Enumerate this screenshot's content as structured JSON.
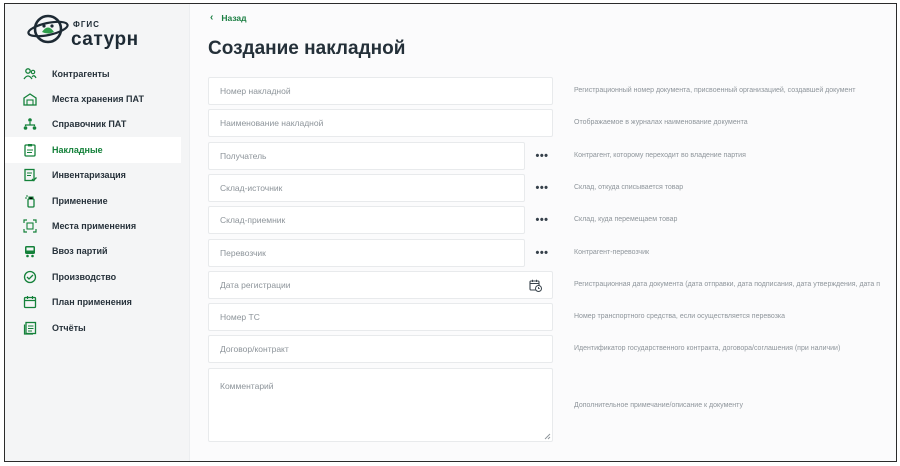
{
  "app": {
    "brand_top": "ФГИС",
    "brand_name": "сатурн"
  },
  "sidebar": {
    "items": [
      {
        "label": "Контрагенты",
        "icon": "users-icon"
      },
      {
        "label": "Места хранения ПАТ",
        "icon": "warehouse-icon"
      },
      {
        "label": "Справочник ПАТ",
        "icon": "hierarchy-icon"
      },
      {
        "label": "Накладные",
        "icon": "clipboard-icon",
        "active": true
      },
      {
        "label": "Инвентаризация",
        "icon": "inventory-icon"
      },
      {
        "label": "Применение",
        "icon": "spray-bottle-icon"
      },
      {
        "label": "Места применения",
        "icon": "field-scan-icon"
      },
      {
        "label": "Ввоз партий",
        "icon": "truck-icon"
      },
      {
        "label": "Производство",
        "icon": "production-icon"
      },
      {
        "label": "План применения",
        "icon": "calendar-icon"
      },
      {
        "label": "Отчёты",
        "icon": "reports-icon"
      }
    ]
  },
  "header": {
    "back_label": "Назад",
    "title": "Создание накладной"
  },
  "form": {
    "fields": [
      {
        "placeholder": "Номер накладной",
        "hint": "Регистрационный номер документа, присвоенный организацией, создавшей документ"
      },
      {
        "placeholder": "Наименование накладной",
        "hint": "Отображаемое в журналах наименование документа"
      },
      {
        "placeholder": "Получатель",
        "hint": "Контрагент, которому переходит во владение партия",
        "more": "•••"
      },
      {
        "placeholder": "Склад-источник",
        "hint": "Склад, откуда списывается товар",
        "more": "•••"
      },
      {
        "placeholder": "Склад-приемник",
        "hint": "Склад, куда перемещаем товар",
        "more": "•••"
      },
      {
        "placeholder": "Перевозчик",
        "hint": "Контрагент-перевозчик",
        "more": "•••"
      },
      {
        "placeholder": "Дата регистрации",
        "hint": "Регистрационная дата документа (дата отправки, дата подписания, дата утверждения, дата п",
        "icon": "calendar-clock-icon"
      },
      {
        "placeholder": "Номер ТС",
        "hint": "Номер транспортного средства, если осуществляется перевозка"
      },
      {
        "placeholder": "Договор/контракт",
        "hint": "Идентификатор государственного контракта, договора/соглашения (при наличии)"
      }
    ],
    "comment": {
      "placeholder": "Комментарий",
      "hint": "Дополнительное примечание/описание к документу"
    }
  },
  "colors": {
    "accent": "#14813a",
    "text": "#243039",
    "sidebar_bg": "#f4f5f6"
  }
}
